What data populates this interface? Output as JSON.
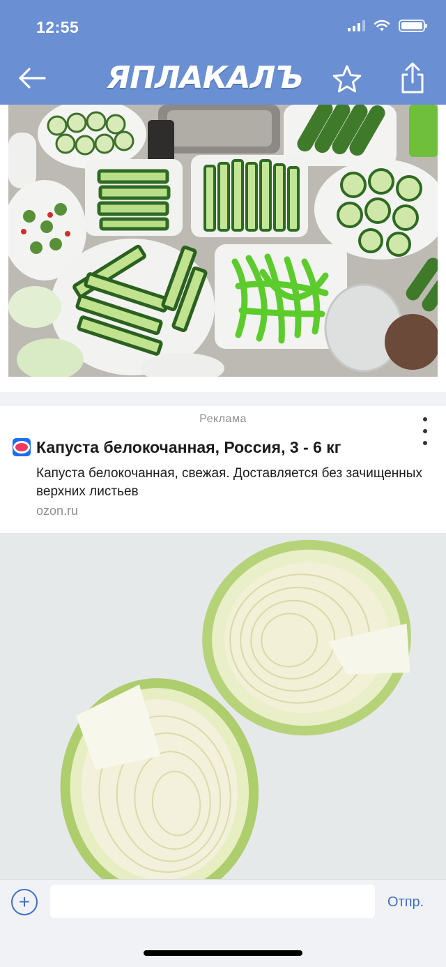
{
  "status": {
    "time": "12:55"
  },
  "header": {
    "logo_text": "ЯПЛАКАЛЪ"
  },
  "ad": {
    "label": "Реклама",
    "title": "Капуста белокочанная, Россия, 3 - 6 кг",
    "description": "Капуста белокочанная, свежая. Доставляется без зачищенных верхних листьев",
    "domain": "ozon.ru"
  },
  "comment": {
    "placeholder": "",
    "send_label": "Отпр.",
    "add_symbol": "+"
  },
  "icons": {
    "back": "arrow-left-icon",
    "favorite": "star-outline-icon",
    "share": "share-icon",
    "more": "more-vertical-icon",
    "advertiser": "ozon-logo-icon",
    "add": "plus-circle-icon"
  },
  "colors": {
    "header_bg": "#6a8fd2",
    "accent": "#3f6ec4",
    "secondary_text": "#8e8e93"
  }
}
